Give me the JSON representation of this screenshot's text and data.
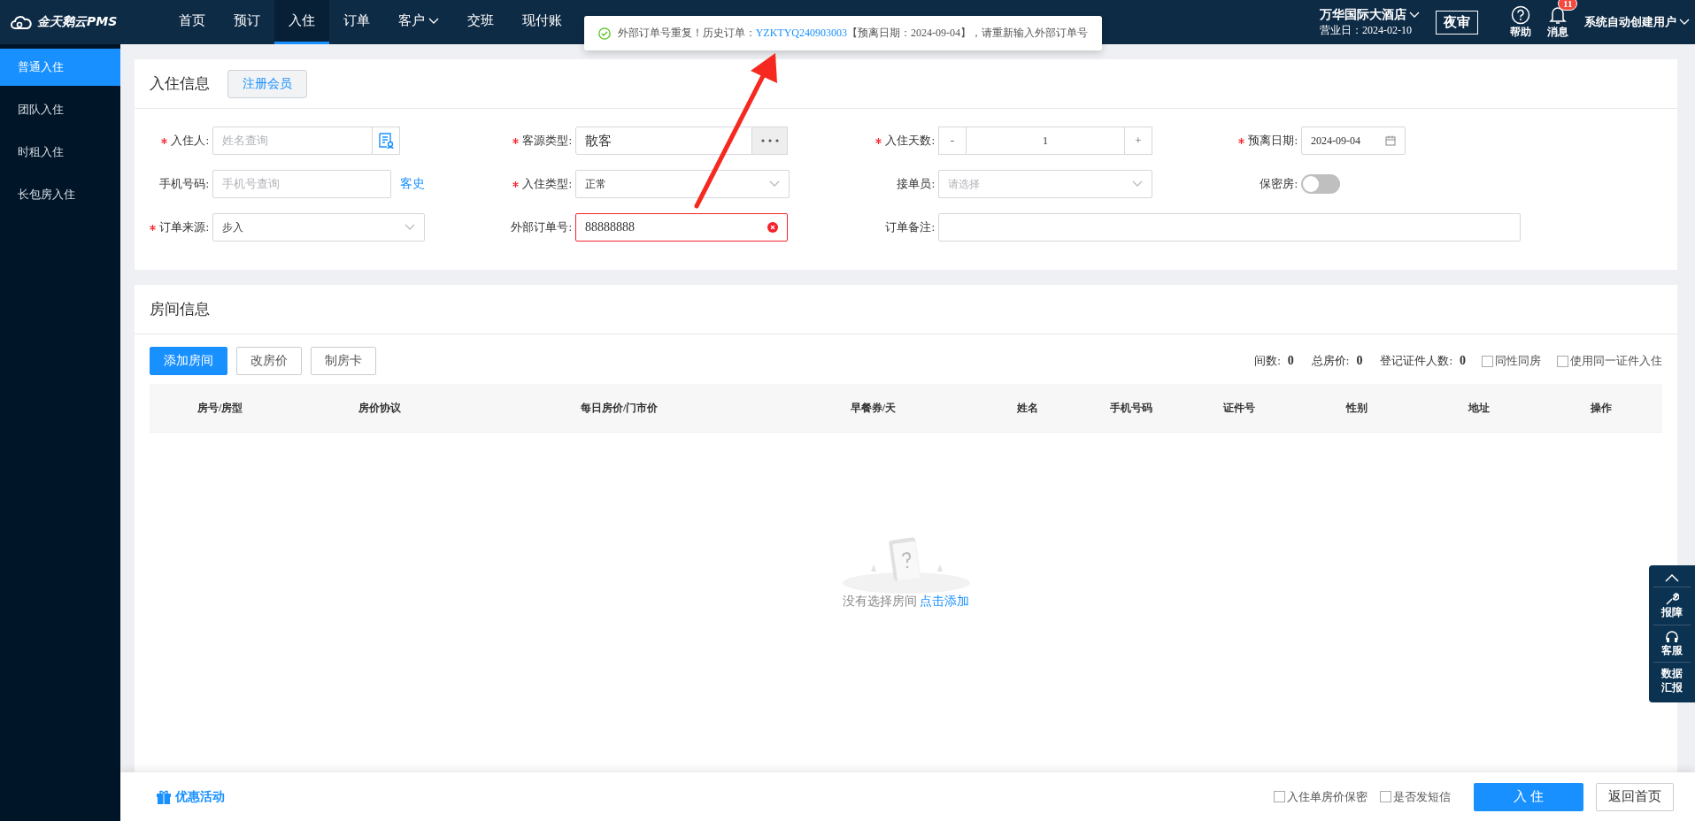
{
  "header": {
    "logo": "金天鹅云PMS",
    "nav": [
      {
        "label": "首页",
        "selected": false,
        "caret": false
      },
      {
        "label": "预订",
        "selected": false,
        "caret": false
      },
      {
        "label": "入住",
        "selected": true,
        "caret": false
      },
      {
        "label": "订单",
        "selected": false,
        "caret": false
      },
      {
        "label": "客户",
        "selected": false,
        "caret": true
      },
      {
        "label": "交班",
        "selected": false,
        "caret": false
      },
      {
        "label": "现付账",
        "selected": false,
        "caret": false
      }
    ],
    "hotel": {
      "name": "万华国际大酒店",
      "business_date": "营业日：2024-02-10"
    },
    "night_audit": "夜审",
    "help": "帮助",
    "messages": {
      "label": "消息",
      "badge": "11"
    },
    "user": "系统自动创建用户"
  },
  "toast": {
    "prefix": "外部订单号重复！历史订单：",
    "link": "YZKTYQ240903003",
    "suffix": "【预离日期：2024-09-04】，请重新输入外部订单号"
  },
  "sidebar": {
    "items": [
      {
        "label": "普通入住",
        "selected": true
      },
      {
        "label": "团队入住",
        "selected": false
      },
      {
        "label": "时租入住",
        "selected": false
      },
      {
        "label": "长包房入住",
        "selected": false
      }
    ]
  },
  "checkin_form": {
    "title": "入住信息",
    "register_button": "注册会员",
    "fields": [
      {
        "kind": "search",
        "label": "入住人:",
        "required": true,
        "placeholder": "姓名查询"
      },
      {
        "kind": "picker",
        "label": "客源类型:",
        "required": true,
        "value": "散客"
      },
      {
        "kind": "stepper",
        "label": "入住天数:",
        "required": true,
        "value": "1",
        "minus": "-",
        "plus": "+"
      },
      {
        "kind": "date",
        "label": "预离日期:",
        "required": true,
        "value": "2024-09-04"
      },
      {
        "kind": "phone",
        "label": "手机号码:",
        "required": false,
        "placeholder": "手机号查询",
        "link": "客史"
      },
      {
        "kind": "select",
        "label": "入住类型:",
        "required": true,
        "value": "正常"
      },
      {
        "kind": "select",
        "label": "接单员:",
        "required": false,
        "placeholder": "请选择"
      },
      {
        "kind": "toggle",
        "label": "保密房:",
        "required": false,
        "on": false
      },
      {
        "kind": "select",
        "label": "订单来源:",
        "required": true,
        "value": "步入"
      },
      {
        "kind": "text",
        "label": "外部订单号:",
        "required": false,
        "value": "88888888",
        "error": true
      },
      {
        "kind": "wide",
        "label": "订单备注:",
        "required": false
      }
    ]
  },
  "room_info": {
    "title": "房间信息",
    "buttons": [
      {
        "label": "添加房间",
        "primary": true
      },
      {
        "label": "改房价",
        "primary": false
      },
      {
        "label": "制房卡",
        "primary": false
      }
    ],
    "stats": [
      {
        "label": "间数:",
        "value": "0"
      },
      {
        "label": "总房价:",
        "value": "0"
      },
      {
        "label": "登记证件人数:",
        "value": "0"
      }
    ],
    "checkboxes": [
      {
        "label": "同性同房",
        "checked": false
      },
      {
        "label": "使用同一证件入住",
        "checked": false
      }
    ],
    "table": {
      "columns": [
        "房号/房型",
        "房价协议",
        "每日房价/门市价",
        "早餐券/天",
        "姓名",
        "手机号码",
        "证件号",
        "性别",
        "地址",
        "操作"
      ]
    },
    "empty": {
      "text": "没有选择房间",
      "link": "点击添加"
    }
  },
  "side_tools": [
    {
      "kind": "up"
    },
    {
      "kind": "wrench",
      "label": "报障"
    },
    {
      "kind": "headset",
      "label": "客服"
    },
    {
      "kind": "plain",
      "label": "数据汇报"
    }
  ],
  "footer": {
    "promo": "优惠活动",
    "checkboxes": [
      {
        "label": "入住单房价保密",
        "checked": false
      },
      {
        "label": "是否发短信",
        "checked": false
      }
    ],
    "primary": "入 住",
    "secondary": "返回首页"
  }
}
